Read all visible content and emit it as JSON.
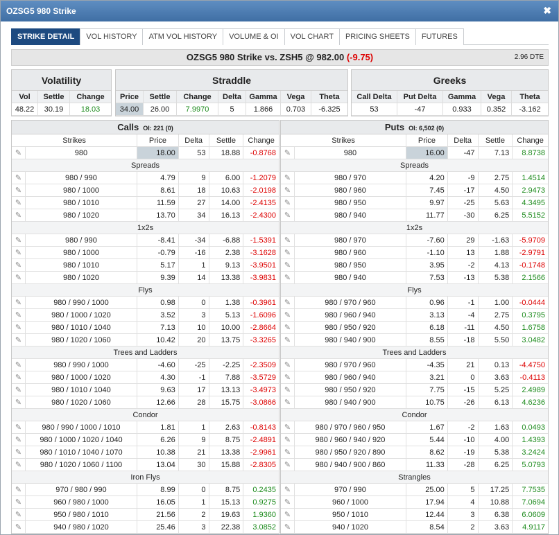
{
  "window": {
    "title": "OZSG5 980 Strike",
    "close": "✖"
  },
  "tabs": [
    "STRIKE DETAIL",
    "VOL HISTORY",
    "ATM VOL HISTORY",
    "VOLUME & OI",
    "VOL CHART",
    "PRICING SHEETS",
    "FUTURES"
  ],
  "headline": {
    "text": "OZSG5 980 Strike vs. ZSH5 @ 982.00",
    "change": "(-9.75)",
    "dte": "2.96 DTE"
  },
  "volatility": {
    "title": "Volatility",
    "labels": [
      "Vol",
      "Settle",
      "Change"
    ],
    "values": [
      "48.22",
      "30.19",
      "18.03"
    ]
  },
  "straddle": {
    "title": "Straddle",
    "labels": [
      "Price",
      "Settle",
      "Change",
      "Delta",
      "Gamma",
      "Vega",
      "Theta"
    ],
    "values": [
      "34.00",
      "26.00",
      "7.9970",
      "5",
      "1.866",
      "0.703",
      "-6.325"
    ]
  },
  "greeks": {
    "title": "Greeks",
    "labels": [
      "Call Delta",
      "Put Delta",
      "Gamma",
      "Vega",
      "Theta"
    ],
    "values": [
      "53",
      "-47",
      "0.933",
      "0.352",
      "-3.162"
    ]
  },
  "columns": [
    "Strikes",
    "Price",
    "Delta",
    "Settle",
    "Change"
  ],
  "calls": {
    "title": "Calls",
    "oi": "OI: 221 (0)",
    "main": [
      "980",
      "18.00",
      "53",
      "18.88",
      "-0.8768"
    ],
    "sections": [
      {
        "name": "Spreads",
        "rows": [
          [
            "980 / 990",
            "4.79",
            "9",
            "6.00",
            "-1.2079"
          ],
          [
            "980 / 1000",
            "8.61",
            "18",
            "10.63",
            "-2.0198"
          ],
          [
            "980 / 1010",
            "11.59",
            "27",
            "14.00",
            "-2.4135"
          ],
          [
            "980 / 1020",
            "13.70",
            "34",
            "16.13",
            "-2.4300"
          ]
        ]
      },
      {
        "name": "1x2s",
        "rows": [
          [
            "980 / 990",
            "-8.41",
            "-34",
            "-6.88",
            "-1.5391"
          ],
          [
            "980 / 1000",
            "-0.79",
            "-16",
            "2.38",
            "-3.1628"
          ],
          [
            "980 / 1010",
            "5.17",
            "1",
            "9.13",
            "-3.9501"
          ],
          [
            "980 / 1020",
            "9.39",
            "14",
            "13.38",
            "-3.9831"
          ]
        ]
      },
      {
        "name": "Flys",
        "rows": [
          [
            "980 / 990 / 1000",
            "0.98",
            "0",
            "1.38",
            "-0.3961"
          ],
          [
            "980 / 1000 / 1020",
            "3.52",
            "3",
            "5.13",
            "-1.6096"
          ],
          [
            "980 / 1010 / 1040",
            "7.13",
            "10",
            "10.00",
            "-2.8664"
          ],
          [
            "980 / 1020 / 1060",
            "10.42",
            "20",
            "13.75",
            "-3.3265"
          ]
        ]
      },
      {
        "name": "Trees and Ladders",
        "rows": [
          [
            "980 / 990 / 1000",
            "-4.60",
            "-25",
            "-2.25",
            "-2.3509"
          ],
          [
            "980 / 1000 / 1020",
            "4.30",
            "-1",
            "7.88",
            "-3.5729"
          ],
          [
            "980 / 1010 / 1040",
            "9.63",
            "17",
            "13.13",
            "-3.4973"
          ],
          [
            "980 / 1020 / 1060",
            "12.66",
            "28",
            "15.75",
            "-3.0866"
          ]
        ]
      },
      {
        "name": "Condor",
        "rows": [
          [
            "980 / 990 / 1000 / 1010",
            "1.81",
            "1",
            "2.63",
            "-0.8143"
          ],
          [
            "980 / 1000 / 1020 / 1040",
            "6.26",
            "9",
            "8.75",
            "-2.4891"
          ],
          [
            "980 / 1010 / 1040 / 1070",
            "10.38",
            "21",
            "13.38",
            "-2.9961"
          ],
          [
            "980 / 1020 / 1060 / 1100",
            "13.04",
            "30",
            "15.88",
            "-2.8305"
          ]
        ]
      },
      {
        "name": "Iron Flys",
        "rows": [
          [
            "970 / 980 / 990",
            "8.99",
            "0",
            "8.75",
            "0.2435"
          ],
          [
            "960 / 980 / 1000",
            "16.05",
            "1",
            "15.13",
            "0.9275"
          ],
          [
            "950 / 980 / 1010",
            "21.56",
            "2",
            "19.63",
            "1.9360"
          ],
          [
            "940 / 980 / 1020",
            "25.46",
            "3",
            "22.38",
            "3.0852"
          ]
        ]
      }
    ]
  },
  "puts": {
    "title": "Puts",
    "oi": "OI: 6,502 (0)",
    "main": [
      "980",
      "16.00",
      "-47",
      "7.13",
      "8.8738"
    ],
    "sections": [
      {
        "name": "Spreads",
        "rows": [
          [
            "980 / 970",
            "4.20",
            "-9",
            "2.75",
            "1.4514"
          ],
          [
            "980 / 960",
            "7.45",
            "-17",
            "4.50",
            "2.9473"
          ],
          [
            "980 / 950",
            "9.97",
            "-25",
            "5.63",
            "4.3495"
          ],
          [
            "980 / 940",
            "11.77",
            "-30",
            "6.25",
            "5.5152"
          ]
        ]
      },
      {
        "name": "1x2s",
        "rows": [
          [
            "980 / 970",
            "-7.60",
            "29",
            "-1.63",
            "-5.9709"
          ],
          [
            "980 / 960",
            "-1.10",
            "13",
            "1.88",
            "-2.9791"
          ],
          [
            "980 / 950",
            "3.95",
            "-2",
            "4.13",
            "-0.1748"
          ],
          [
            "980 / 940",
            "7.53",
            "-13",
            "5.38",
            "2.1566"
          ]
        ]
      },
      {
        "name": "Flys",
        "rows": [
          [
            "980 / 970 / 960",
            "0.96",
            "-1",
            "1.00",
            "-0.0444"
          ],
          [
            "980 / 960 / 940",
            "3.13",
            "-4",
            "2.75",
            "0.3795"
          ],
          [
            "980 / 950 / 920",
            "6.18",
            "-11",
            "4.50",
            "1.6758"
          ],
          [
            "980 / 940 / 900",
            "8.55",
            "-18",
            "5.50",
            "3.0482"
          ]
        ]
      },
      {
        "name": "Trees and Ladders",
        "rows": [
          [
            "980 / 970 / 960",
            "-4.35",
            "21",
            "0.13",
            "-4.4750"
          ],
          [
            "980 / 960 / 940",
            "3.21",
            "0",
            "3.63",
            "-0.4113"
          ],
          [
            "980 / 950 / 920",
            "7.75",
            "-15",
            "5.25",
            "2.4989"
          ],
          [
            "980 / 940 / 900",
            "10.75",
            "-26",
            "6.13",
            "4.6236"
          ]
        ]
      },
      {
        "name": "Condor",
        "rows": [
          [
            "980 / 970 / 960 / 950",
            "1.67",
            "-2",
            "1.63",
            "0.0493"
          ],
          [
            "980 / 960 / 940 / 920",
            "5.44",
            "-10",
            "4.00",
            "1.4393"
          ],
          [
            "980 / 950 / 920 / 890",
            "8.62",
            "-19",
            "5.38",
            "3.2424"
          ],
          [
            "980 / 940 / 900 / 860",
            "11.33",
            "-28",
            "6.25",
            "5.0793"
          ]
        ]
      },
      {
        "name": "Strangles",
        "rows": [
          [
            "970 / 990",
            "25.00",
            "5",
            "17.25",
            "7.7535"
          ],
          [
            "960 / 1000",
            "17.94",
            "4",
            "10.88",
            "7.0694"
          ],
          [
            "950 / 1010",
            "12.44",
            "3",
            "6.38",
            "6.0609"
          ],
          [
            "940 / 1020",
            "8.54",
            "2",
            "3.63",
            "4.9117"
          ]
        ]
      }
    ]
  }
}
